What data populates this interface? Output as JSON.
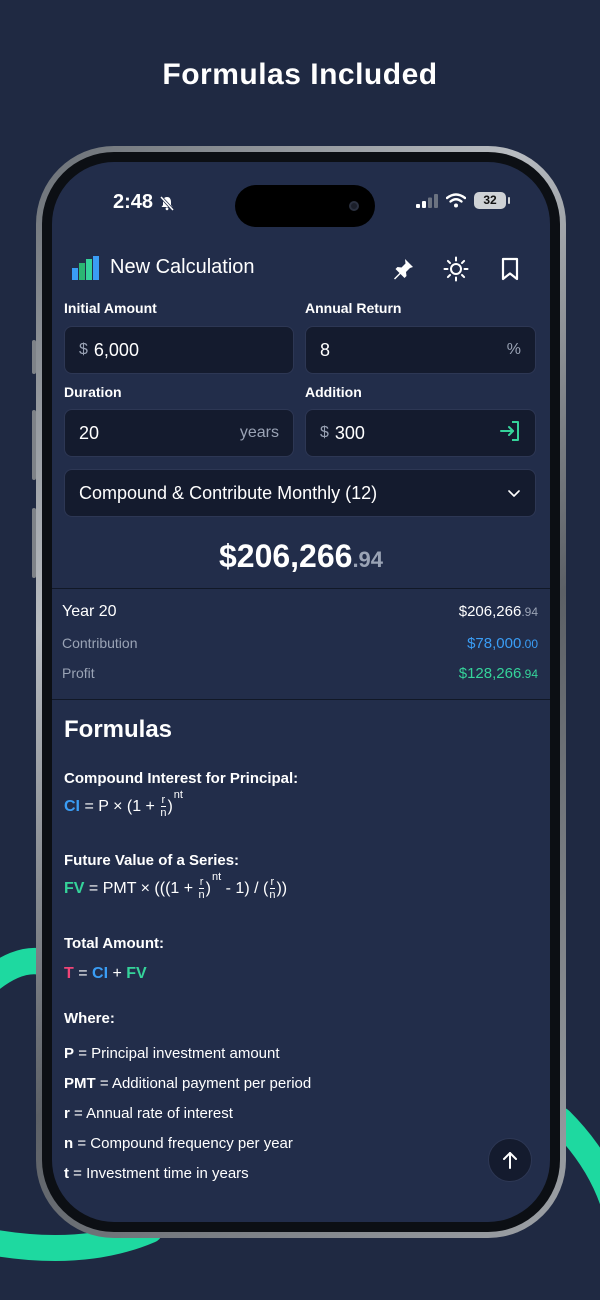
{
  "headline": "Formulas Included",
  "status_bar": {
    "time": "2:48",
    "battery": "32"
  },
  "app": {
    "title": "New Calculation"
  },
  "inputs": {
    "initial_amount": {
      "label": "Initial Amount",
      "prefix": "$",
      "value": "6,000"
    },
    "annual_return": {
      "label": "Annual Return",
      "value": "8",
      "suffix": "%"
    },
    "duration": {
      "label": "Duration",
      "value": "20",
      "suffix": "years"
    },
    "addition": {
      "label": "Addition",
      "prefix": "$",
      "value": "300"
    }
  },
  "frequency": {
    "selected": "Compound & Contribute Monthly (12)"
  },
  "result": {
    "total_main": "$206,266",
    "total_cents": ".94"
  },
  "summary": {
    "year_label": "Year 20",
    "year_value": "$206,266",
    "year_cents": ".94",
    "contribution_label": "Contribution",
    "contribution_value": "$78,000",
    "contribution_cents": ".00",
    "profit_label": "Profit",
    "profit_value": "$128,266",
    "profit_cents": ".94"
  },
  "formulas": {
    "heading": "Formulas",
    "ci_title": "Compound Interest for Principal:",
    "ci_sym": "CI",
    "ci_eq_a": "= P × (1 +",
    "fv_title": "Future Value of a Series:",
    "fv_sym": "FV",
    "fv_eq_a": "= PMT × (((1 +",
    "fv_eq_b": "- 1) / (",
    "fv_eq_c": "))",
    "total_title": "Total Amount:",
    "t_sym": "T",
    "frac_num": "r",
    "frac_den": "n",
    "exp": "nt",
    "where_title": "Where:",
    "defs": [
      {
        "sym": "P",
        "text": "= Principal investment amount"
      },
      {
        "sym": "PMT",
        "text": "= Additional payment per period"
      },
      {
        "sym": "r",
        "text": "= Annual rate of interest"
      },
      {
        "sym": "n",
        "text": "= Compound frequency per year"
      },
      {
        "sym": "t",
        "text": "= Investment time in years"
      }
    ]
  },
  "colors": {
    "background": "#1f2942",
    "screen": "#222d4a",
    "accent_green": "#35d39a",
    "accent_blue": "#3a9df5",
    "accent_pink": "#f04477"
  }
}
